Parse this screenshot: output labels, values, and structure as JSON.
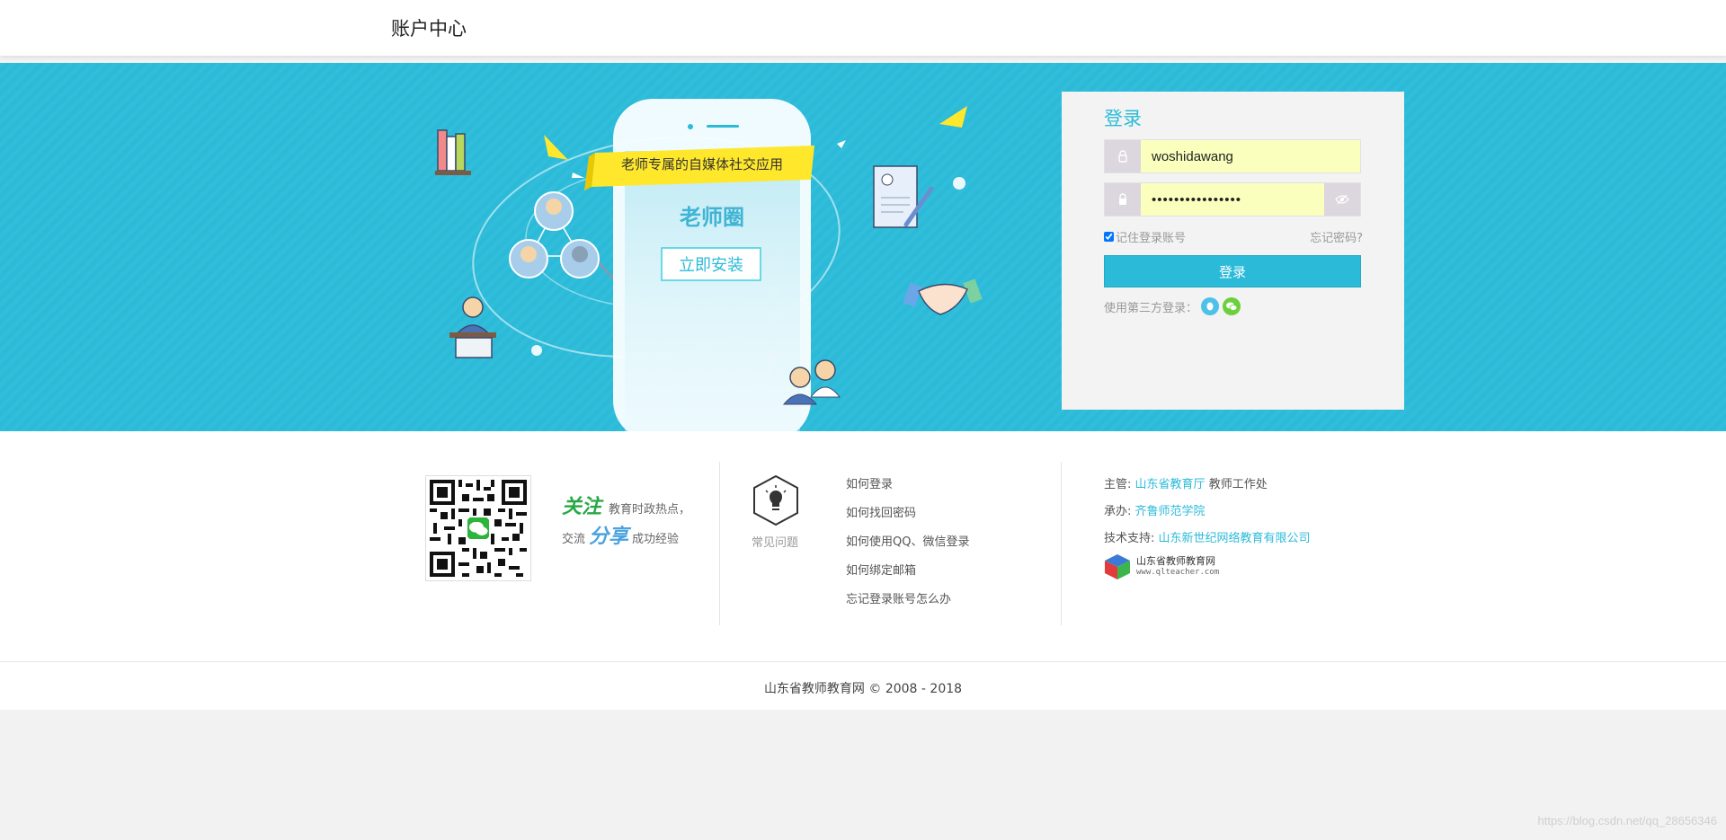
{
  "header": {
    "title": "账户中心"
  },
  "banner": {
    "slogan": "老师专属的自媒体社交应用",
    "app_name": "老师圈",
    "install_label": "立即安装"
  },
  "login": {
    "title": "登录",
    "username_value": "woshidawang",
    "password_value": "••••••••••••••••",
    "remember_label": "记住登录账号",
    "forgot_label": "忘记密码?",
    "submit_label": "登录",
    "third_party_label": "使用第三方登录：",
    "third_party_icons": [
      "qq-icon",
      "wechat-icon"
    ]
  },
  "info": {
    "follow": {
      "word1": "关注",
      "text1": "教育时政热点，",
      "text2_prefix": "交流",
      "word2": "分享",
      "text2": "成功经验"
    },
    "faq": {
      "label": "常见问题",
      "items": [
        "如何登录",
        "如何找回密码",
        "如何使用QQ、微信登录",
        "如何绑定邮箱",
        "忘记登录账号怎么办"
      ]
    },
    "org": {
      "host_label": "主管:",
      "host_link": "山东省教育厅",
      "host_suffix": "教师工作处",
      "organizer_label": "承办:",
      "organizer_link": "齐鲁师范学院",
      "support_label": "技术支持:",
      "support_link": "山东新世纪网络教育有限公司",
      "logo_cn": "山东省教师教育网",
      "logo_en": "www.qlteacher.com"
    }
  },
  "footer": {
    "copyright": "山东省教师教育网 © 2008 - 2018"
  },
  "watermark": "https://blog.csdn.net/qq_28656346",
  "colors": {
    "accent": "#2bbbd9",
    "autofill": "#faffbd",
    "green": "#28a844"
  }
}
